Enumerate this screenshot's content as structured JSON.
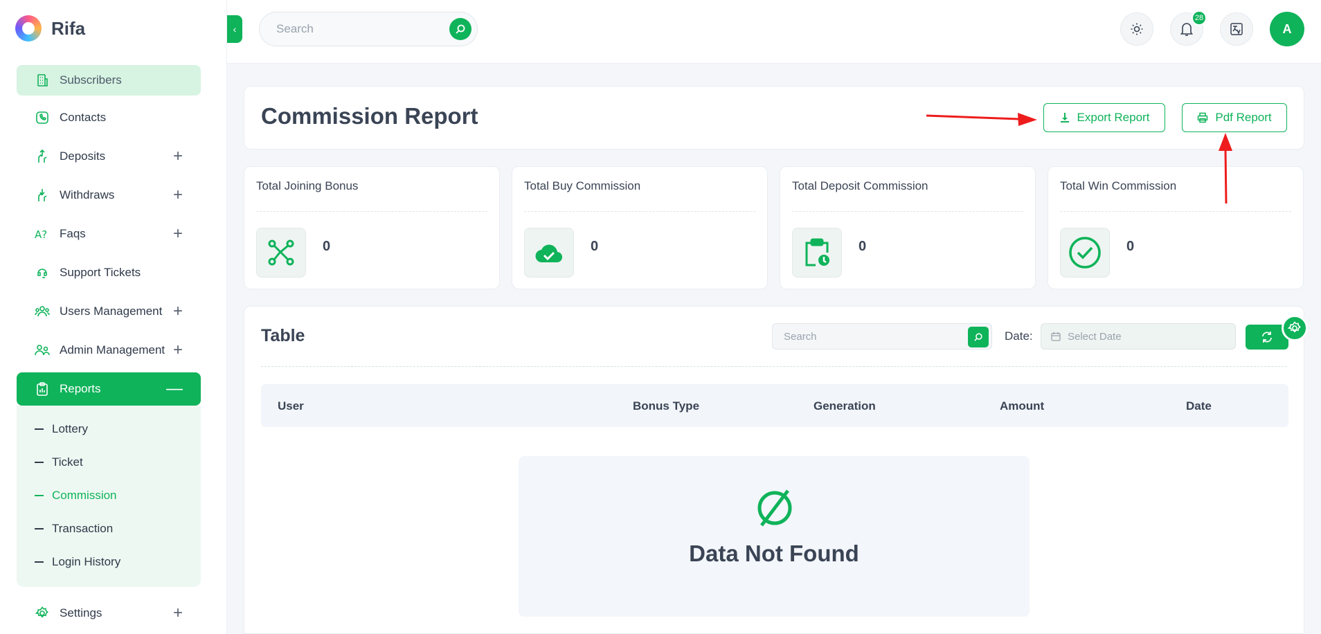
{
  "app": {
    "name": "Rifa"
  },
  "sidebar": {
    "items": [
      {
        "label": "Subscribers"
      },
      {
        "label": "Contacts"
      },
      {
        "label": "Deposits"
      },
      {
        "label": "Withdraws"
      },
      {
        "label": "Faqs"
      },
      {
        "label": "Support Tickets"
      },
      {
        "label": "Users Management"
      },
      {
        "label": "Admin Management"
      },
      {
        "label": "Reports"
      },
      {
        "label": "Settings"
      }
    ],
    "reports_submenu": [
      {
        "label": "Lottery"
      },
      {
        "label": "Ticket"
      },
      {
        "label": "Commission"
      },
      {
        "label": "Transaction"
      },
      {
        "label": "Login History"
      }
    ]
  },
  "topbar": {
    "search_placeholder": "Search",
    "notification_count": "28",
    "avatar_initial": "A"
  },
  "header": {
    "title": "Commission Report",
    "export_label": "Export Report",
    "pdf_label": "Pdf Report"
  },
  "stats": [
    {
      "label": "Total Joining Bonus",
      "value": "0",
      "icon": "share-nodes-icon"
    },
    {
      "label": "Total Buy Commission",
      "value": "0",
      "icon": "cloud-check-icon"
    },
    {
      "label": "Total Deposit Commission",
      "value": "0",
      "icon": "clipboard-clock-icon"
    },
    {
      "label": "Total Win Commission",
      "value": "0",
      "icon": "check-circle-icon"
    }
  ],
  "table": {
    "title": "Table",
    "search_placeholder": "Search",
    "date_label": "Date:",
    "date_placeholder": "Select Date",
    "columns": [
      "User",
      "Bonus Type",
      "Generation",
      "Amount",
      "Date"
    ],
    "empty_message": "Data Not Found"
  },
  "colors": {
    "accent": "#0fb35a",
    "annotation": "#ee1c1c"
  }
}
